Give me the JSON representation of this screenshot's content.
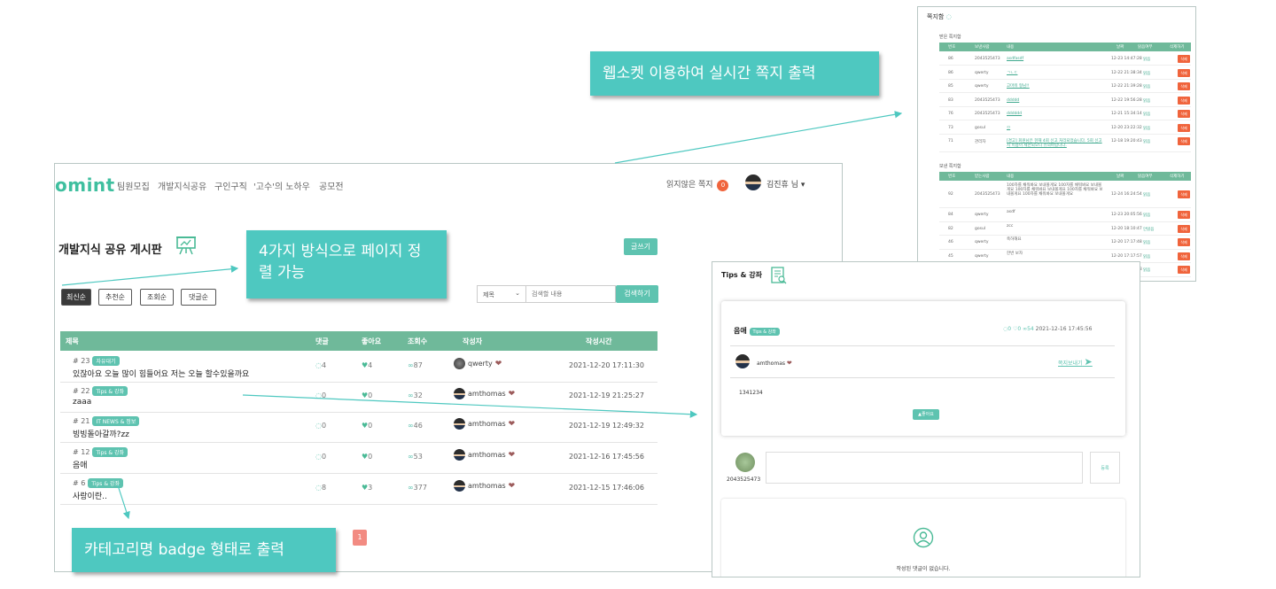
{
  "colors": {
    "brand": "#3fbf9f",
    "teal": "#5ec3b0",
    "header": "#6fb99a",
    "annotation": "#4ec8c0",
    "danger": "#f0643c",
    "pagination": "#f28b82"
  },
  "board": {
    "logo": "omint",
    "nav": [
      "팀원모집",
      "개발지식공유",
      "구인구직",
      "'고수'의 노하우",
      "공모전"
    ],
    "unread_label": "읽지않은 쪽지",
    "unread_count": "0",
    "user_name": "김진휴 님 ▾",
    "page_title": "개발지식 공유 게시판",
    "write_button": "글쓰기",
    "sort_buttons": [
      "최신순",
      "추천순",
      "조회순",
      "댓글순"
    ],
    "search_select": "제목",
    "search_placeholder": "검색할 내용",
    "search_button": "검색하기",
    "columns": [
      "제목",
      "댓글",
      "좋아요",
      "조회수",
      "작성자",
      "작성시간"
    ],
    "rows": [
      {
        "num": "# 23",
        "category": "자유대기",
        "title": "있잖아요 오늘 많이 힘들어요 저는 오늘 할수있을까요",
        "comments": "4",
        "likes": "4",
        "views": "87",
        "writer": "qwerty",
        "date": "2021-12-20 17:11:30"
      },
      {
        "num": "# 22",
        "category": "Tips & 강좌",
        "title": "zaaa",
        "comments": "0",
        "likes": "0",
        "views": "32",
        "writer": "amthomas",
        "date": "2021-12-19 21:25:27"
      },
      {
        "num": "# 21",
        "category": "IT NEWS & 정보",
        "title": "빙빙돌아갈까?zz",
        "comments": "0",
        "likes": "0",
        "views": "46",
        "writer": "amthomas",
        "date": "2021-12-19 12:49:32"
      },
      {
        "num": "# 12",
        "category": "Tips & 강좌",
        "title": "음애",
        "comments": "0",
        "likes": "0",
        "views": "53",
        "writer": "amthomas",
        "date": "2021-12-16 17:45:56"
      },
      {
        "num": "# 6",
        "category": "Tips & 강좌",
        "title": "사랑이란..",
        "comments": "8",
        "likes": "3",
        "views": "377",
        "writer": "amthomas",
        "date": "2021-12-15 17:46:06"
      }
    ],
    "page": "1"
  },
  "annotations": {
    "websocket": "웹소켓 이용하여 실시간 쪽지 출력",
    "sort": "4가지 방식으로 페이지 정렬 가능",
    "badge": "카테고리명 badge 형태로 출력"
  },
  "note": {
    "title": "쪽지함",
    "received_label": "받은 쪽지함",
    "received_cols": [
      "번호",
      "보낸사람",
      "내용",
      "날짜",
      "읽음여부",
      "삭제하기"
    ],
    "received": [
      {
        "no": "86",
        "from": "2043525473",
        "content": "asdfasdf",
        "date": "12-23 14:47:28",
        "read": "읽음"
      },
      {
        "no": "86",
        "from": "qwerty",
        "content": "ㄱㄴㄷ",
        "date": "12-22 21:38:34",
        "read": "읽음"
      },
      {
        "no": "85",
        "from": "qwerty",
        "content": "고마워 형님!!",
        "date": "12-22 21:39:28",
        "read": "읽음"
      },
      {
        "no": "83",
        "from": "2043525473",
        "content": "ddddd",
        "date": "12-22 19:56:28",
        "read": "읽음"
      },
      {
        "no": "76",
        "from": "2043525473",
        "content": "dddddd",
        "date": "12-21 15:34:14",
        "read": "읽음"
      },
      {
        "no": "73",
        "from": "gosul",
        "content": "ㅁ",
        "date": "12-20 23:22:32",
        "read": "읽음"
      },
      {
        "no": "71",
        "from": "관리자",
        "content": "[경고] 회원님은 현재 4회 신고 처리되었습니다. 5회 신고 시 이용이 제한되오니 유의바랍니다.",
        "date": "12-18 19:20:43",
        "read": "읽음"
      }
    ],
    "sent_label": "보낸 쪽지함",
    "sent_cols": [
      "번호",
      "받는사람",
      "내용",
      "날짜",
      "읽음여부",
      "삭제하기"
    ],
    "sent": [
      {
        "no": "92",
        "to": "2043525473",
        "content": "100자를 채워봐요 보내볼게요 100자를 채워봐요 보내볼게요 100자를 채워봐요 보내볼게요 100자를 채워봐요 보내볼게요 100자를 채워봐요 보내볼게요",
        "date": "12-24 16:24:54",
        "read": "읽음"
      },
      {
        "no": "84",
        "to": "qwerty",
        "content": "asdf",
        "date": "12-23 20:05:56",
        "read": "읽음"
      },
      {
        "no": "82",
        "to": "gosul",
        "content": "zcc",
        "date": "12-20 18:10:47",
        "read": "안읽음"
      },
      {
        "no": "46",
        "to": "qwerty",
        "content": "축하해요",
        "date": "12-20 17:17:48",
        "read": "읽음"
      },
      {
        "no": "45",
        "to": "qwerty",
        "content": "한번 보자",
        "date": "12-20 17:17:57",
        "read": "읽음"
      },
      {
        "no": "44",
        "to": "koala",
        "content": "ㅋㅋㅋㅋㅋㅋㅋㅋㅋㅋㅋㅋㅋㅋㅋㅋㅋㅋㅋ",
        "date": "12-18 16:41:28",
        "read": "읽음"
      }
    ],
    "delete_label": "삭제"
  },
  "tips": {
    "title": "Tips & 강좌",
    "post_title": "음애",
    "post_badge": "Tips & 강좌",
    "comments": "0",
    "likes": "0",
    "views": "54",
    "date": "2021-12-16 17:45:56",
    "author": "amthomas",
    "send_note": "쪽지보내기",
    "body": "1341234",
    "like_button": "좋아요",
    "commenter": "2043525473",
    "submit": "등록",
    "empty": "작성된 댓글이 없습니다."
  }
}
